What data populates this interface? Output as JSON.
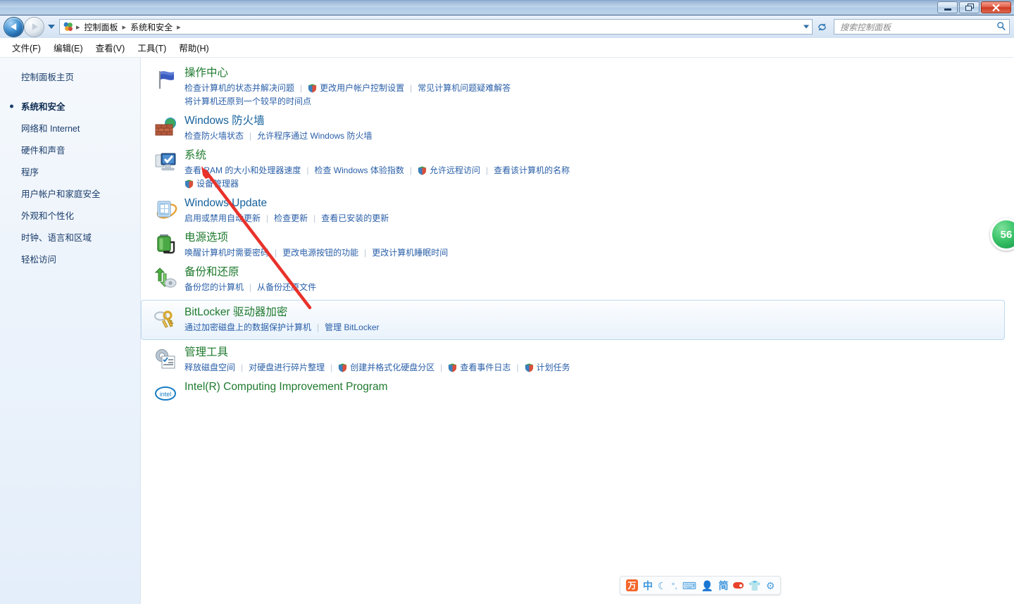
{
  "window": {
    "minimize_label": "–",
    "restore_label": "❐",
    "close_label": "✕"
  },
  "nav": {
    "back_icon": "back-arrow-icon",
    "forward_icon": "forward-arrow-icon",
    "recent_icon": "recent-pages-icon",
    "breadcrumbs": [
      "控制面板",
      "系统和安全"
    ],
    "refresh_icon": "refresh-icon",
    "search_placeholder": "搜索控制面板",
    "search_icon": "search-icon"
  },
  "menubar": {
    "items": [
      "文件(F)",
      "编辑(E)",
      "查看(V)",
      "工具(T)",
      "帮助(H)"
    ]
  },
  "sidebar": {
    "home": "控制面板主页",
    "items": [
      {
        "label": "系统和安全",
        "active": true
      },
      {
        "label": "网络和 Internet",
        "active": false
      },
      {
        "label": "硬件和声音",
        "active": false
      },
      {
        "label": "程序",
        "active": false
      },
      {
        "label": "用户帐户和家庭安全",
        "active": false
      },
      {
        "label": "外观和个性化",
        "active": false
      },
      {
        "label": "时钟、语言和区域",
        "active": false
      },
      {
        "label": "轻松访问",
        "active": false
      }
    ]
  },
  "sections": [
    {
      "id": "action-center",
      "icon": "flag-icon",
      "title": "操作中心",
      "title_color": "green",
      "links_row1": [
        {
          "text": "检查计算机的状态并解决问题",
          "shield": false
        },
        {
          "text": "更改用户帐户控制设置",
          "shield": true
        },
        {
          "text": "常见计算机问题疑难解答",
          "shield": false
        }
      ],
      "links_row2": [
        {
          "text": "将计算机还原到一个较早的时间点",
          "shield": false
        }
      ]
    },
    {
      "id": "windows-firewall",
      "icon": "firewall-icon",
      "title": "Windows 防火墙",
      "title_color": "blue",
      "links_row1": [
        {
          "text": "检查防火墙状态",
          "shield": false
        },
        {
          "text": "允许程序通过 Windows 防火墙",
          "shield": false
        }
      ],
      "links_row2": []
    },
    {
      "id": "system",
      "icon": "system-monitor-icon",
      "title": "系统",
      "title_color": "green",
      "links_row1": [
        {
          "text": "查看 RAM 的大小和处理器速度",
          "shield": false
        },
        {
          "text": "检查 Windows 体验指数",
          "shield": false
        },
        {
          "text": "允许远程访问",
          "shield": true
        },
        {
          "text": "查看该计算机的名称",
          "shield": false
        }
      ],
      "links_row2": [
        {
          "text": "设备管理器",
          "shield": true
        }
      ]
    },
    {
      "id": "windows-update",
      "icon": "windows-update-icon",
      "title": "Windows Update",
      "title_color": "blue",
      "links_row1": [
        {
          "text": "启用或禁用自动更新",
          "shield": false
        },
        {
          "text": "检查更新",
          "shield": false
        },
        {
          "text": "查看已安装的更新",
          "shield": false
        }
      ],
      "links_row2": []
    },
    {
      "id": "power-options",
      "icon": "battery-icon",
      "title": "电源选项",
      "title_color": "green",
      "links_row1": [
        {
          "text": "唤醒计算机时需要密码",
          "shield": false
        },
        {
          "text": "更改电源按钮的功能",
          "shield": false
        },
        {
          "text": "更改计算机睡眠时间",
          "shield": false
        }
      ],
      "links_row2": []
    },
    {
      "id": "backup-restore",
      "icon": "backup-icon",
      "title": "备份和还原",
      "title_color": "green",
      "links_row1": [
        {
          "text": "备份您的计算机",
          "shield": false
        },
        {
          "text": "从备份还原文件",
          "shield": false
        }
      ],
      "links_row2": []
    },
    {
      "id": "bitlocker",
      "icon": "bitlocker-key-icon",
      "title": "BitLocker 驱动器加密",
      "title_color": "green",
      "hovered": true,
      "links_row1": [
        {
          "text": "通过加密磁盘上的数据保护计算机",
          "shield": false
        },
        {
          "text": "管理 BitLocker",
          "shield": false
        }
      ],
      "links_row2": []
    },
    {
      "id": "admin-tools",
      "icon": "admin-tools-icon",
      "title": "管理工具",
      "title_color": "green",
      "links_row1": [
        {
          "text": "释放磁盘空间",
          "shield": false
        },
        {
          "text": "对硬盘进行碎片整理",
          "shield": false
        },
        {
          "text": "创建并格式化硬盘分区",
          "shield": true
        },
        {
          "text": "查看事件日志",
          "shield": true
        },
        {
          "text": "计划任务",
          "shield": true
        }
      ],
      "links_row2": []
    },
    {
      "id": "intel-program",
      "icon": "intel-logo-icon",
      "title": "Intel(R) Computing Improvement Program",
      "title_color": "green",
      "links_row1": [],
      "links_row2": []
    }
  ],
  "badge": {
    "value": "56"
  },
  "ime": {
    "logo_text": "万",
    "mode_text": "中",
    "moon_icon": "moon-icon",
    "punctuation_icon": "punctuation-icon",
    "keyboard_icon": "keyboard-icon",
    "person_icon": "person-icon",
    "simplified_text": "简",
    "capsule_icon": "capsule-icon",
    "shirt_icon": "shirt-icon",
    "gear_icon": "gear-icon"
  },
  "colors": {
    "title_green": "#1f7a2e",
    "title_blue": "#15619c",
    "link_blue": "#2a5fa8",
    "badge_green": "#2fb55e",
    "annotation_red": "#e8322a"
  }
}
